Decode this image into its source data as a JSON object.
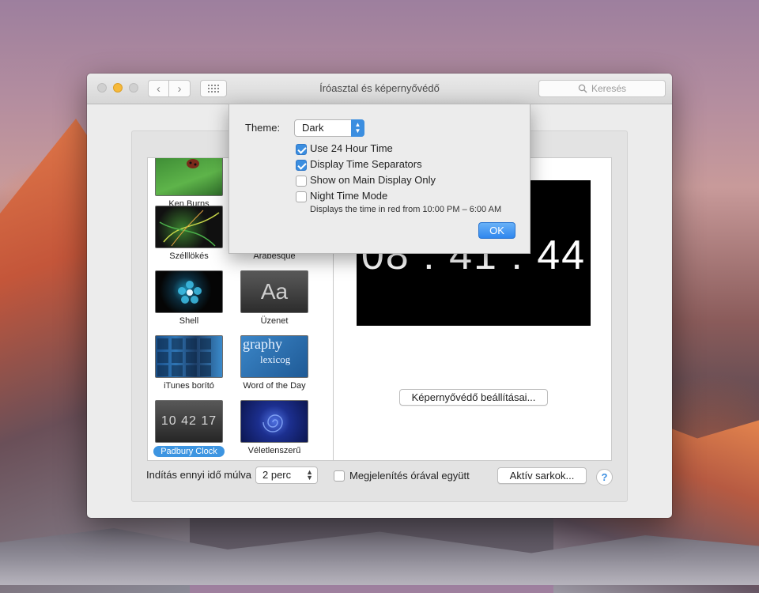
{
  "window": {
    "title": "Íróasztal és képernyővédő",
    "search_placeholder": "Keresés"
  },
  "savers": [
    {
      "label": "Ken Burns",
      "selected": false
    },
    {
      "label": "Arabesque",
      "selected": false
    },
    {
      "label": "Szélllökés",
      "selected": false
    },
    {
      "label": "Shell",
      "selected": false
    },
    {
      "label": "Üzenet",
      "selected": false
    },
    {
      "label": "iTunes borító",
      "selected": false
    },
    {
      "label": "Word of the Day",
      "selected": false
    },
    {
      "label": "Padbury Clock",
      "selected": true
    },
    {
      "label": "Véletlenszerű",
      "selected": false
    }
  ],
  "thumb_text": {
    "uzenet": "Aa",
    "wotd_line1": "graphy",
    "wotd_line2": "lexicog",
    "padbury": "10 42 17"
  },
  "preview": {
    "time": "08 : 41 : 44"
  },
  "buttons": {
    "screensaver_options": "Képernyővédő beállításai...",
    "active_corners": "Aktív sarkok...",
    "help": "?"
  },
  "start": {
    "label": "Indítás ennyi idő múlva",
    "value": "2 perc"
  },
  "show_with_clock": {
    "label": "Megjelenítés órával együtt",
    "checked": false
  },
  "sheet": {
    "theme_label": "Theme:",
    "theme_value": "Dark",
    "options": [
      {
        "label": "Use 24 Hour Time",
        "checked": true
      },
      {
        "label": "Display Time Separators",
        "checked": true
      },
      {
        "label": "Show on Main Display Only",
        "checked": false
      },
      {
        "label": "Night Time Mode",
        "checked": false
      }
    ],
    "note": "Displays the time in red from 10:00 PM – 6:00 AM",
    "ok": "OK"
  },
  "colors": {
    "accent": "#3b8ee0",
    "selection": "#3d95e1"
  }
}
